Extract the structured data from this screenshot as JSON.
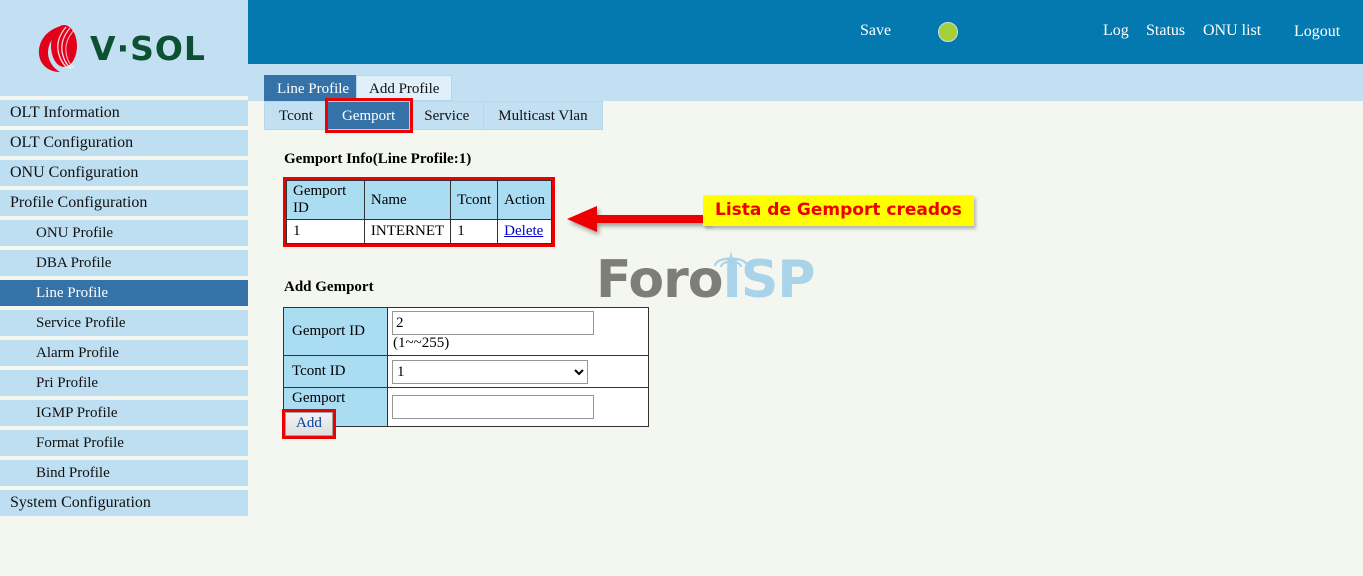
{
  "brand": {
    "name": "V·SOL",
    "logo_icon": "vsol-flame-logo",
    "text_color": "#0b5132",
    "mark_color": "#e2001a"
  },
  "topbar": {
    "background": "#0379b0",
    "save_label": "Save",
    "status_indicator": {
      "icon": "green-status-circle",
      "color": "#a6ce39"
    },
    "log_label": "Log",
    "status_label": "Status",
    "onu_list_label": "ONU list",
    "logout_label": "Logout"
  },
  "sidebar": {
    "active_color": "#3572a8",
    "item_color": "#bddff1",
    "items": [
      {
        "label": "OLT Information",
        "level": "top",
        "active": false
      },
      {
        "label": "OLT Configuration",
        "level": "top",
        "active": false
      },
      {
        "label": "ONU Configuration",
        "level": "top",
        "active": false
      },
      {
        "label": "Profile Configuration",
        "level": "top",
        "active": false
      },
      {
        "label": "ONU Profile",
        "level": "sub",
        "active": false
      },
      {
        "label": "DBA Profile",
        "level": "sub",
        "active": false
      },
      {
        "label": "Line Profile",
        "level": "sub",
        "active": true
      },
      {
        "label": "Service Profile",
        "level": "sub",
        "active": false
      },
      {
        "label": "Alarm Profile",
        "level": "sub",
        "active": false
      },
      {
        "label": "Pri Profile",
        "level": "sub",
        "active": false
      },
      {
        "label": "IGMP Profile",
        "level": "sub",
        "active": false
      },
      {
        "label": "Format Profile",
        "level": "sub",
        "active": false
      },
      {
        "label": "Bind Profile",
        "level": "sub",
        "active": false
      },
      {
        "label": "System Configuration",
        "level": "top",
        "active": false
      }
    ]
  },
  "primary_tabs": [
    {
      "label": "Line Profile",
      "active": true
    },
    {
      "label": "Add Profile",
      "active": false
    }
  ],
  "secondary_tabs": [
    {
      "label": "Tcont",
      "active": false,
      "highlighted": false
    },
    {
      "label": "Gemport",
      "active": true,
      "highlighted": true
    },
    {
      "label": "Service",
      "active": false,
      "highlighted": false
    },
    {
      "label": "Multicast Vlan",
      "active": false,
      "highlighted": false
    }
  ],
  "gemport_info": {
    "title": "Gemport Info(Line Profile:1)",
    "highlighted": true,
    "columns": [
      "Gemport ID",
      "Name",
      "Tcont",
      "Action"
    ],
    "rows": [
      {
        "gemport_id": "1",
        "name": "INTERNET",
        "tcont": "1",
        "action": "Delete"
      }
    ]
  },
  "annotation": {
    "arrow_icon": "left-arrow-annotation",
    "arrow_color": "#ee0000",
    "label_text": "Lista de Gemport creados",
    "label_bg": "#ffff00",
    "label_color": "#ee0000"
  },
  "watermark": {
    "text_part1": "Foro",
    "text_part2": "ISP",
    "icon": "antenna-tower-icon",
    "color1": "#7d7d7a",
    "color2": "#a9d3e9"
  },
  "add_gemport": {
    "title": "Add Gemport",
    "fields": {
      "gemport_id": {
        "label": "Gemport ID",
        "value": "2",
        "placeholder": "",
        "range_hint": "(1~~255)"
      },
      "tcont_id": {
        "label": "Tcont ID",
        "value": "1",
        "options": [
          "1"
        ]
      },
      "gemport_name": {
        "label": "Gemport Name",
        "value": "",
        "placeholder": ""
      }
    },
    "add_button": {
      "label": "Add",
      "highlighted": true
    }
  }
}
